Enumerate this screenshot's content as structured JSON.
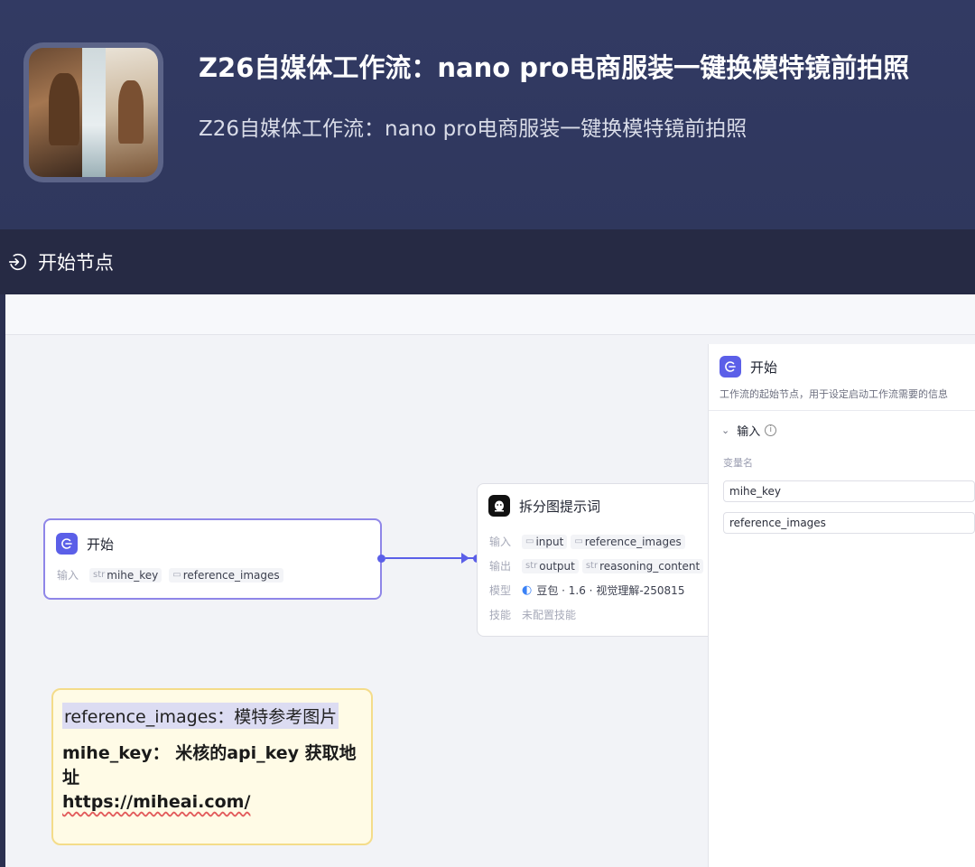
{
  "header": {
    "title": "Z26自媒体工作流：nano pro电商服装一键换模特镜前拍照",
    "subtitle": "Z26自媒体工作流：nano pro电商服装一键换模特镜前拍照"
  },
  "section": {
    "label": "开始节点"
  },
  "canvas": {
    "start_node": {
      "title": "开始",
      "input_label": "输入",
      "inputs": [
        {
          "type": "str",
          "name": "mihe_key"
        },
        {
          "type": "",
          "name": "reference_images"
        }
      ]
    },
    "split_node": {
      "title": "拆分图提示词",
      "input_label": "输入",
      "inputs": [
        {
          "type": "",
          "name": "input"
        },
        {
          "type": "",
          "name": "reference_images"
        }
      ],
      "output_label": "输出",
      "outputs": [
        {
          "type": "str",
          "name": "output"
        },
        {
          "type": "str",
          "name": "reasoning_content"
        }
      ],
      "model_label": "模型",
      "model_value": "豆包 · 1.6 · 视觉理解-250815",
      "skill_label": "技能",
      "skill_value": "未配置技能"
    },
    "note": {
      "line1": "reference_images：模特参考图片",
      "line2": "mihe_key： 米核的api_key 获取地址",
      "line3": "https://miheai.com/"
    }
  },
  "panel": {
    "title": "开始",
    "description": "工作流的起始节点，用于设定启动工作流需要的信息",
    "section_label": "输入",
    "column_label": "变量名",
    "fields": [
      "mihe_key",
      "reference_images"
    ]
  },
  "colors": {
    "accent": "#5b5fe8",
    "header_bg": "#323a63",
    "note_bg": "#fffbe6"
  }
}
